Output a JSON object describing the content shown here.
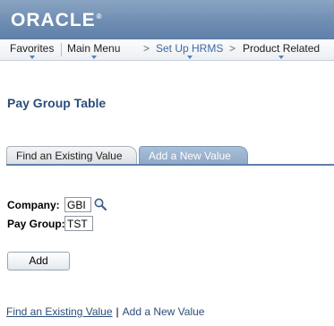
{
  "banner": {
    "logo_text": "ORACLE",
    "logo_mark": "®"
  },
  "nav": {
    "items": [
      {
        "label": "Favorites"
      },
      {
        "label": "Main Menu"
      },
      {
        "label": "Set Up HRMS"
      },
      {
        "label": "Product Related"
      }
    ],
    "chevron": ">"
  },
  "page": {
    "title": "Pay Group Table"
  },
  "tabs": [
    {
      "label": "Find an Existing Value",
      "active": false
    },
    {
      "label": "Add a New Value",
      "active": true
    }
  ],
  "form": {
    "company": {
      "label": "Company:",
      "value": "GBI"
    },
    "pay_group": {
      "label": "Pay Group:",
      "value": "TST"
    }
  },
  "buttons": {
    "add": "Add"
  },
  "bottom_links": {
    "find": "Find an Existing Value",
    "separator": "|",
    "add": "Add a New Value"
  },
  "colors": {
    "banner": "#6f8db3",
    "title": "#2b4e7a",
    "tab_active": "#8ea8c7"
  }
}
